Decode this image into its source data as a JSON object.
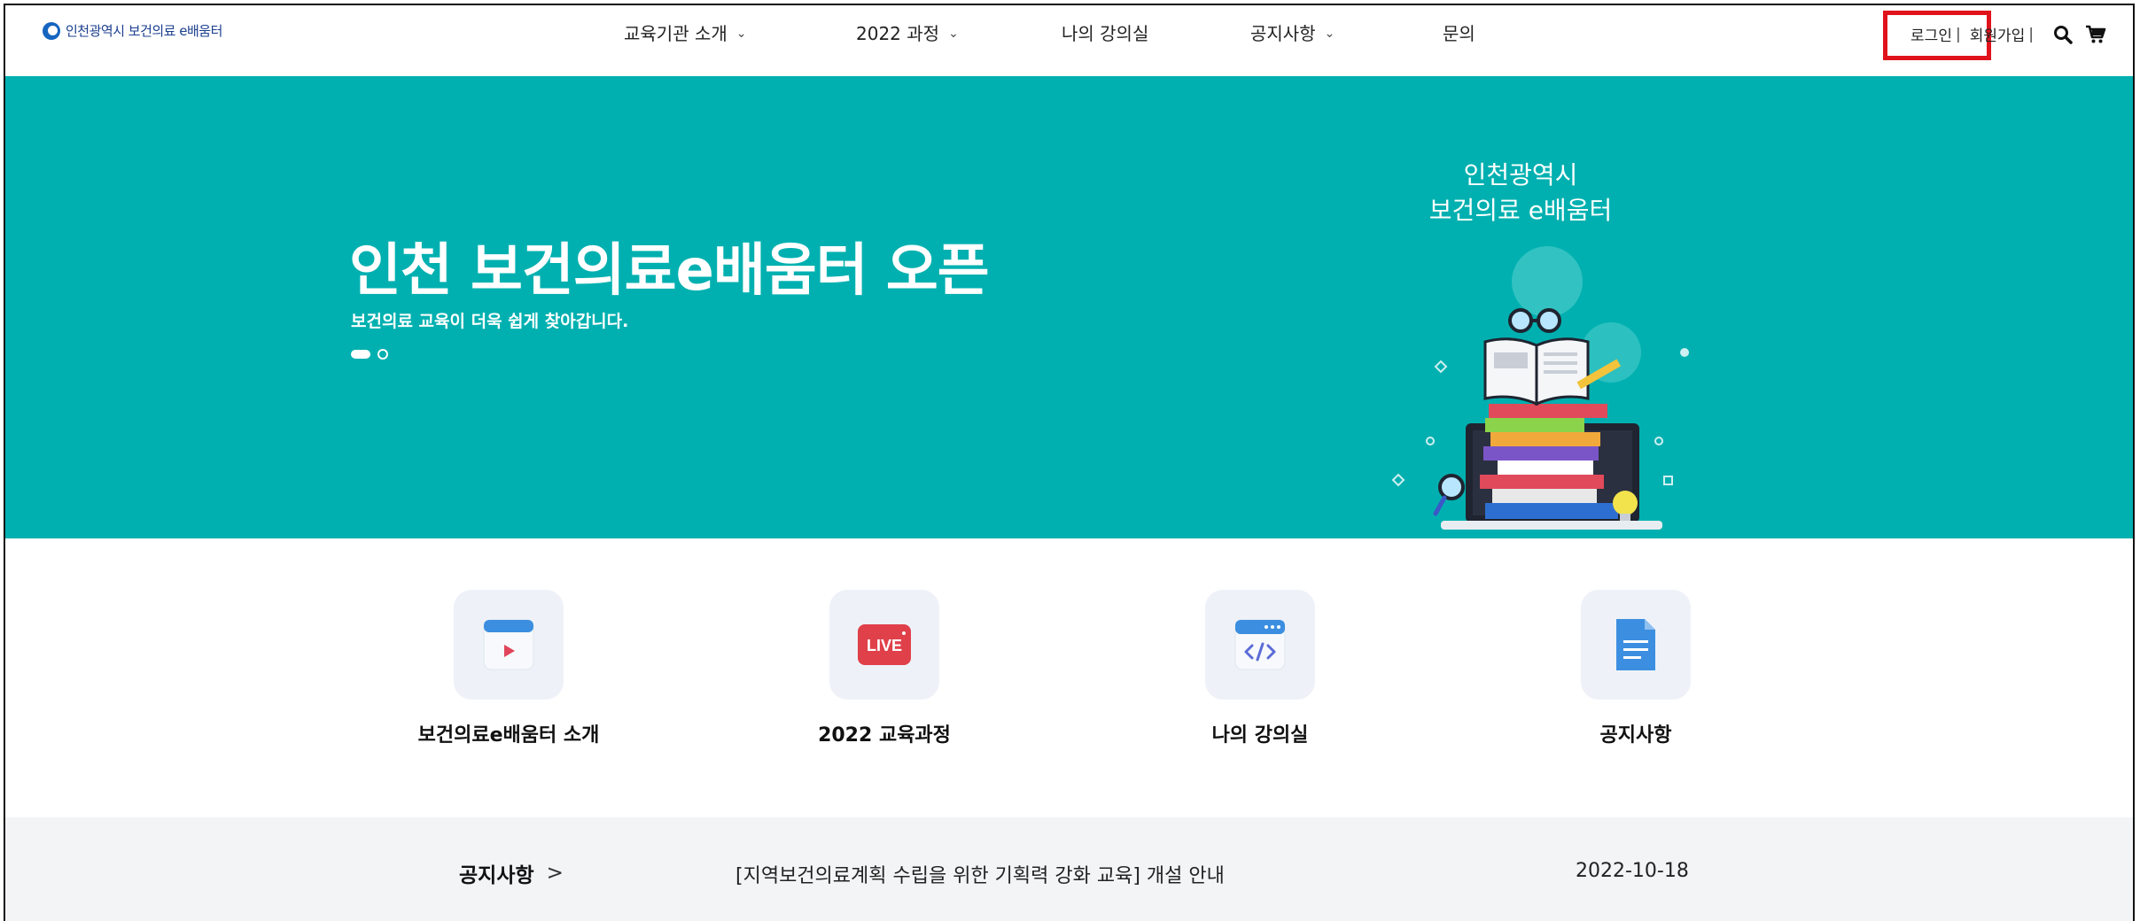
{
  "header": {
    "logo_text": "인천광역시 보건의료 e배움터",
    "nav": [
      {
        "label": "교육기관 소개",
        "has_dropdown": true
      },
      {
        "label": "2022 과정",
        "has_dropdown": true
      },
      {
        "label": "나의 강의실",
        "has_dropdown": false
      },
      {
        "label": "공지사항",
        "has_dropdown": true
      },
      {
        "label": "문의",
        "has_dropdown": false
      }
    ],
    "util": {
      "login": "로그인",
      "signup": "회원가입",
      "separator": "|",
      "search_icon": "search-icon",
      "cart_icon": "cart-icon"
    },
    "highlight_color": "#e0131c"
  },
  "hero": {
    "title": "인천 보건의료e배움터 오픈",
    "subtitle": "보건의료 교육이 더욱 쉽게 찾아갑니다.",
    "art_title_line1": "인천광역시",
    "art_title_line2": "보건의료 e배움터",
    "background": "#00b0b0",
    "slides_total": 2,
    "active_slide": 1
  },
  "quick_menu": [
    {
      "label": "보건의료e배움터 소개",
      "icon": "video-play-icon"
    },
    {
      "label": "2022 교육과정",
      "icon": "live-icon",
      "icon_text": "LIVE"
    },
    {
      "label": "나의 강의실",
      "icon": "code-window-icon"
    },
    {
      "label": "공지사항",
      "icon": "document-icon"
    }
  ],
  "notice": {
    "title": "공지사항",
    "arrow": ">",
    "text": "[지역보건의료계획 수립을 위한 기획력 강화 교육] 개설 안내",
    "date": "2022-10-18"
  }
}
